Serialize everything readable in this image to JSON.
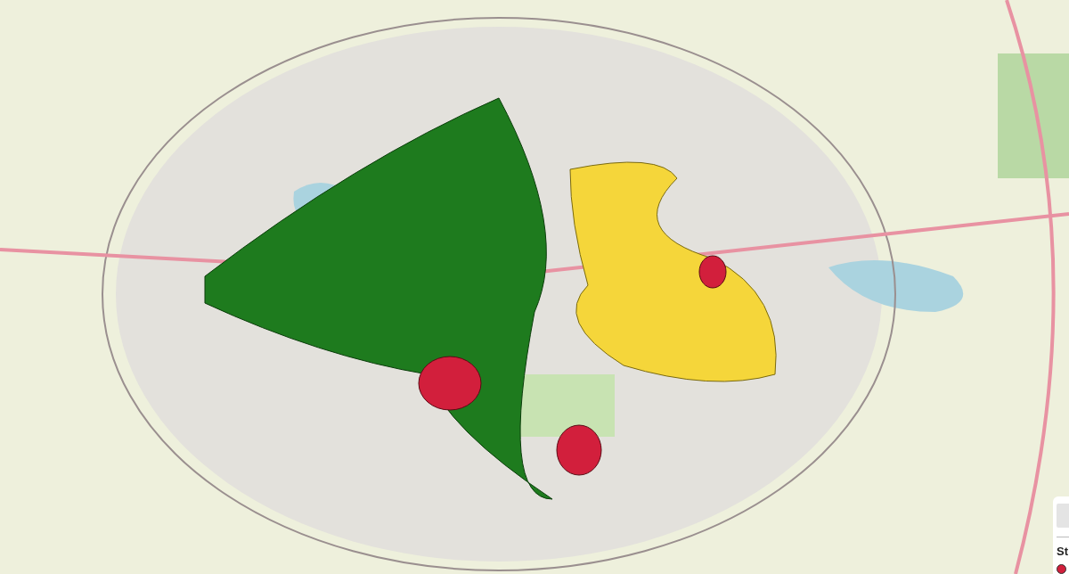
{
  "legend": {
    "title": "St",
    "items": [
      {
        "color": "#d21f3c"
      }
    ]
  }
}
